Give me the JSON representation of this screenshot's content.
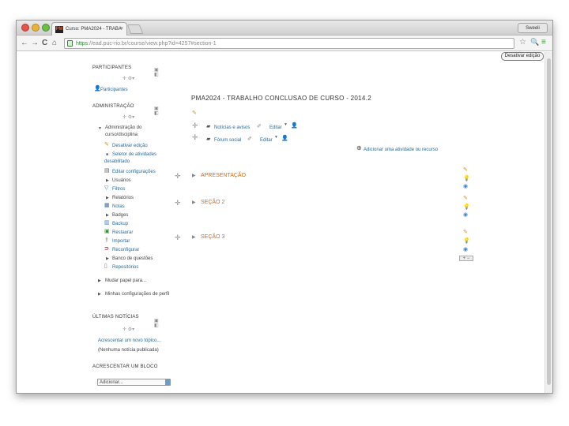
{
  "browser": {
    "tab_title": "Curso: PMA2024 - TRABA",
    "tab_favicon": "PM",
    "tab_close": "×",
    "profile": "Sweeli",
    "url_protocol": "https",
    "url_rest": "://ead.puc-rio.br/course/view.php?id=4257#section-1",
    "back": "←",
    "forward": "→",
    "reload": "C",
    "home": "⌂",
    "star": "☆",
    "zoom": "🔍",
    "menu": "≡"
  },
  "page": {
    "desativar_button": "Desativar edição",
    "course_title": "PMA2024 - TRABALHO CONCLUSAO DE CURSO - 2014.2",
    "edit_pencil": "✎",
    "activities": [
      {
        "label": "Notícias e avisos",
        "edit": "Editar"
      },
      {
        "label": "Fórum social",
        "edit": "Editar"
      }
    ],
    "add_activity": "Adicionar uma atividade ou recurso",
    "sections": [
      {
        "title": "APRESENTAÇÃO"
      },
      {
        "title": "SEÇÃO 2"
      },
      {
        "title": "SEÇÃO 3"
      }
    ],
    "add_remove": "+ −"
  },
  "sidebar": {
    "participantes": {
      "title": "PARTICIPANTES",
      "move": "✛ ⚙▾",
      "item": "Participantes"
    },
    "administracao": {
      "title": "ADMINISTRAÇÃO",
      "move": "✛ ⚙▾",
      "items": [
        "Administração do curso/disciplina",
        "Desativar edição",
        "Seletor de atividades desabilitado",
        "Editar configurações",
        "Usuários",
        "Filtros",
        "Relatórios",
        "Notas",
        "Badges",
        "Backup",
        "Restaurar",
        "Importar",
        "Reconfigurar",
        "Banco de questões",
        "Repositórios",
        "Mudar papel para...",
        "Minhas configurações de perfil"
      ]
    },
    "ultimas_noticias": {
      "title": "ÚLTIMAS NOTÍCIAS",
      "move": "✛ ⚙▾",
      "add_topic": "Acrescentar um novo tópico...",
      "none": "(Nenhuma notícia publicada)"
    },
    "acrescentar_bloco": {
      "title": "ACRESCENTAR UM BLOCO",
      "select": "Adicionar..."
    }
  }
}
